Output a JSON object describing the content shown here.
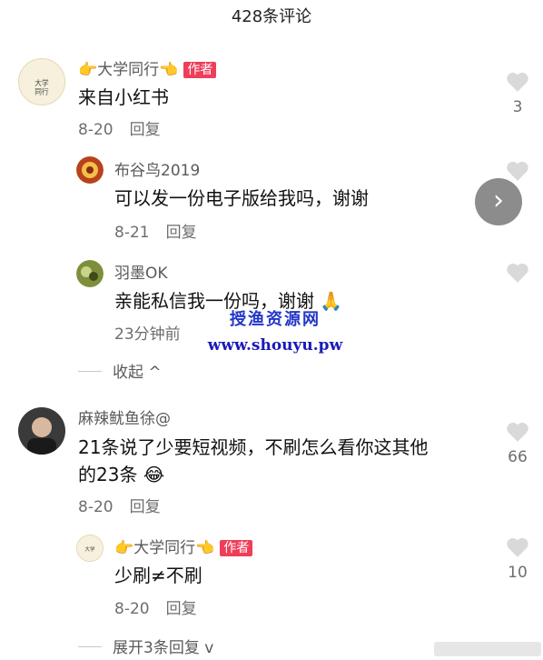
{
  "header": {
    "title": "428条评论"
  },
  "comments": [
    {
      "name": "👉大学同行👈",
      "author_badge": "作者",
      "content": "来自小红书",
      "date": "8-20",
      "reply_label": "回复",
      "likes": "3",
      "replies": [
        {
          "name": "布谷鸟2019",
          "content": "可以发一份电子版给我吗，谢谢",
          "date": "8-21",
          "reply_label": "回复"
        },
        {
          "name": "羽墨OK",
          "content": "亲能私信我一份吗，谢谢",
          "emoji": "🙏",
          "time": "23分钟前",
          "collapse_label": "收起"
        }
      ]
    },
    {
      "name": "麻辣鱿鱼徐@",
      "content_line1": "21条说了少要短视频，不刷怎么看你这其他",
      "content_line2": "的23条",
      "emoji": "😂",
      "date": "8-20",
      "reply_label": "回复",
      "likes": "66",
      "replies": [
        {
          "name": "👉大学同行👈",
          "author_badge": "作者",
          "content": "少刷≠不刷",
          "date": "8-20",
          "reply_label": "回复",
          "likes": "10"
        }
      ],
      "expand_label": "展开3条回复"
    }
  ],
  "watermark": {
    "line1": "授渔资源网",
    "line2": "www.shouyu.pw"
  },
  "colors": {
    "author_badge": "#ee3e5a",
    "heart": "#d9d9d9",
    "watermark": "#2236c8"
  }
}
